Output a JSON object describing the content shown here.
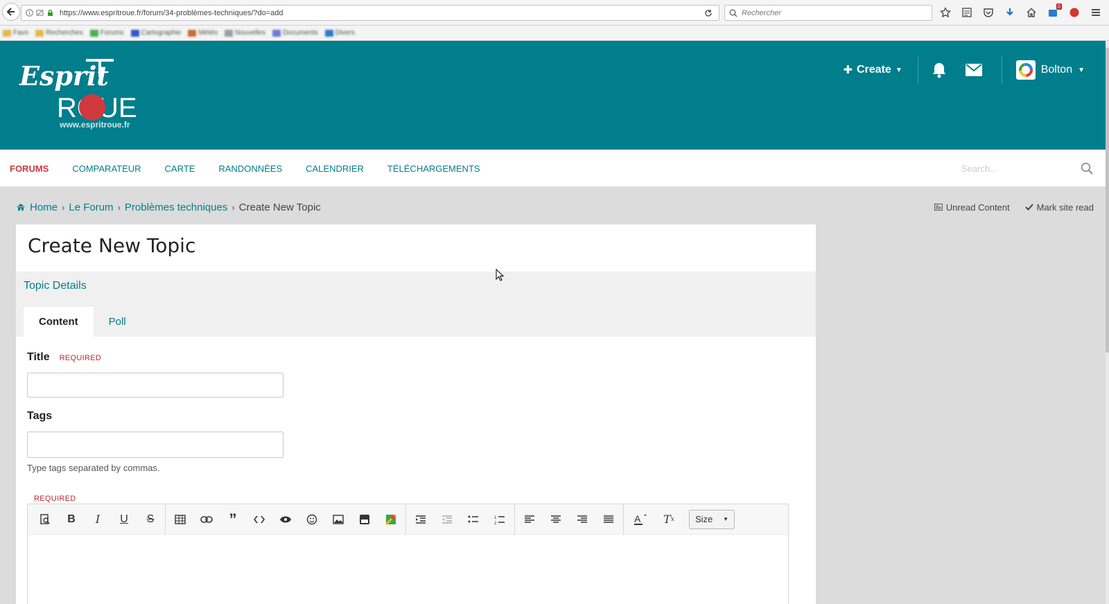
{
  "browser": {
    "url": "https://www.espritroue.fr/forum/34-problèmes-techniques/?do=add",
    "search_placeholder": "Rechercher",
    "badge_count": "0",
    "bookmarks": [
      "Favo",
      "Recherches",
      "Forums",
      "Cartographie",
      "Météo",
      "Nouvelles",
      "Documents",
      "Divers"
    ]
  },
  "header": {
    "logo_text_top": "Esprit",
    "logo_text_main": "ROUE",
    "logo_url": "www.espritroue.fr",
    "create_label": "Create",
    "user_name": "Bolton"
  },
  "nav": {
    "items": [
      "FORUMS",
      "COMPARATEUR",
      "CARTE",
      "RANDONNÉES",
      "CALENDRIER",
      "TÉLÉCHARGEMENTS"
    ],
    "search_placeholder": "Search..."
  },
  "breadcrumb": {
    "items": [
      "Home",
      "Le Forum",
      "Problèmes techniques"
    ],
    "current": "Create New Topic"
  },
  "page_actions": {
    "unread": "Unread Content",
    "mark_read": "Mark site read"
  },
  "form": {
    "page_title": "Create New Topic",
    "section_title": "Topic Details",
    "tabs": [
      "Content",
      "Poll"
    ],
    "title_label": "Title",
    "required_label": "REQUIRED",
    "title_value": "",
    "tags_label": "Tags",
    "tags_value": "",
    "tags_hint": "Type tags separated by commas.",
    "editor_required": "REQUIRED",
    "size_label": "Size"
  },
  "colors": {
    "brand": "#007e8c",
    "active_nav": "#d0383f",
    "required": "#c0262d"
  }
}
